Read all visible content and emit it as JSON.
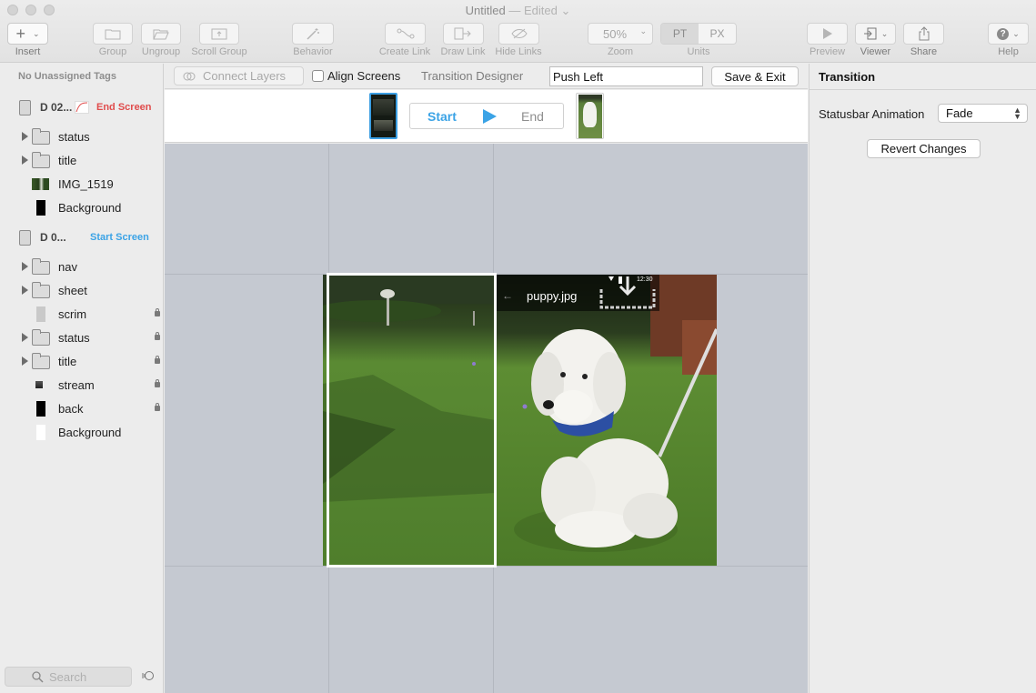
{
  "window": {
    "title": "Untitled",
    "status": "— Edited ⌄"
  },
  "toolbar": {
    "insert": "Insert",
    "group": "Group",
    "ungroup": "Ungroup",
    "scroll_group": "Scroll Group",
    "behavior": "Behavior",
    "create_link": "Create Link",
    "draw_link": "Draw Link",
    "hide_links": "Hide Links",
    "zoom_value": "50%",
    "zoom": "Zoom",
    "units_pt": "PT",
    "units_px": "PX",
    "units": "Units",
    "preview": "Preview",
    "viewer": "Viewer",
    "share": "Share",
    "help": "Help"
  },
  "sidebar": {
    "tags_header": "No Unassigned Tags",
    "screens": [
      {
        "name": "D 02...",
        "tag": "End Screen",
        "tag_color": "#e04c4c",
        "layers": [
          {
            "name": "status",
            "type": "folder",
            "locked": false
          },
          {
            "name": "title",
            "type": "folder",
            "locked": false
          },
          {
            "name": "IMG_1519",
            "type": "image",
            "locked": false
          },
          {
            "name": "Background",
            "type": "black",
            "locked": false
          }
        ]
      },
      {
        "name": "D 0...",
        "tag": "Start Screen",
        "tag_color": "#3ba3e6",
        "layers": [
          {
            "name": "nav",
            "type": "folder",
            "locked": false
          },
          {
            "name": "sheet",
            "type": "folder",
            "locked": false
          },
          {
            "name": "scrim",
            "type": "grey",
            "locked": true
          },
          {
            "name": "status",
            "type": "folder",
            "locked": true
          },
          {
            "name": "title",
            "type": "folder",
            "locked": true
          },
          {
            "name": "stream",
            "type": "stream",
            "locked": true
          },
          {
            "name": "back",
            "type": "black",
            "locked": true
          },
          {
            "name": "Background",
            "type": "white",
            "locked": false
          }
        ]
      }
    ],
    "search_placeholder": "Search"
  },
  "subbar": {
    "connect_layers": "Connect Layers",
    "align_screens": "Align Screens",
    "transition_designer": "Transition Designer",
    "transition_name": "Push Left",
    "save_exit": "Save & Exit"
  },
  "transition": {
    "start": "Start",
    "end": "End"
  },
  "canvas": {
    "picture_title": "puppy.jpg",
    "status_time": "12:30"
  },
  "inspector": {
    "title": "Transition",
    "statusbar_label": "Statusbar Animation",
    "statusbar_value": "Fade",
    "revert": "Revert Changes"
  }
}
